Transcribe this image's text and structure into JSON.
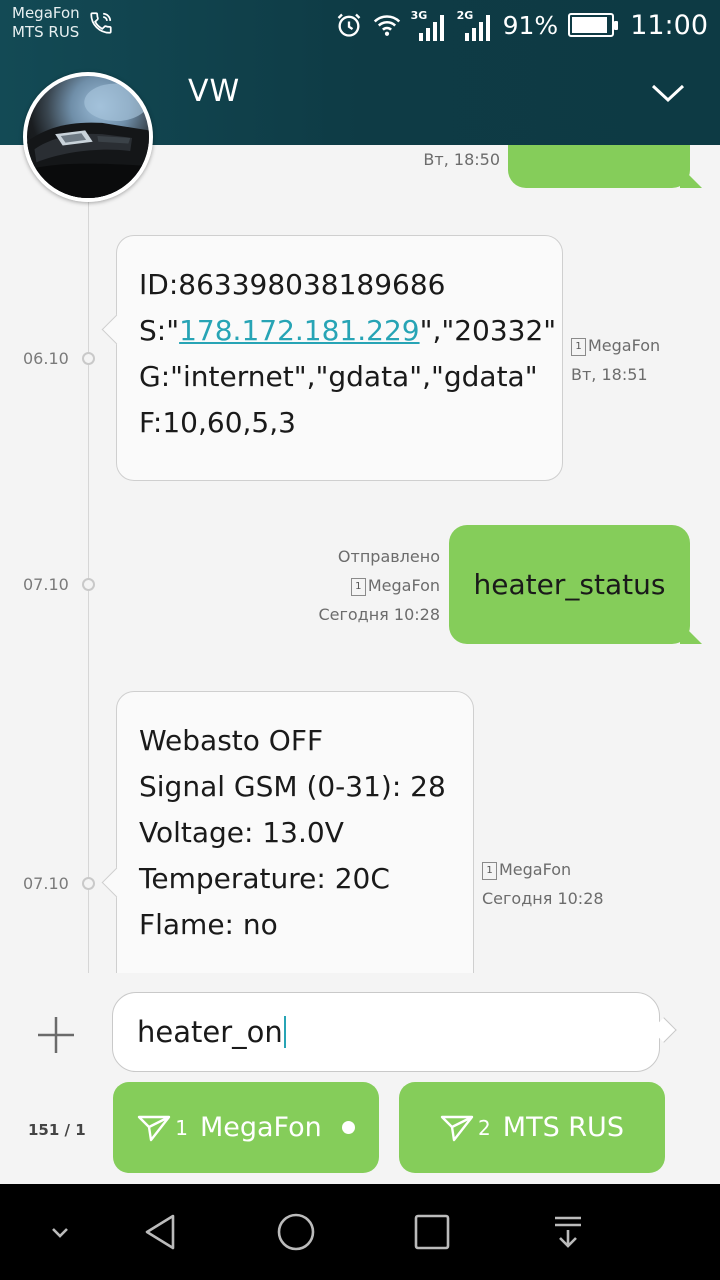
{
  "status_bar": {
    "carrier_1": "MegaFon",
    "carrier_2": "MTS RUS",
    "net_1": "3G",
    "net_2": "2G",
    "battery_pct": "91%",
    "battery_level": 0.91,
    "time": "11:00"
  },
  "header": {
    "contact_name": "VW"
  },
  "messages": {
    "prev_out": {
      "time": "Вт, 18:50"
    },
    "in_1": {
      "date": "06.10",
      "line1": "ID:863398038189686",
      "line2_prefix": "S:\"",
      "line2_link": "178.172.181.229",
      "line2_suffix": "\",\"20332\"",
      "line3": "G:\"internet\",\"gdata\",\"gdata\"",
      "line4": "F:10,60,5,3",
      "sim": "1",
      "carrier": "MegaFon",
      "time": "Вт, 18:51"
    },
    "out_1": {
      "date": "07.10",
      "text": "heater_status",
      "status": "Отправлено",
      "sim": "1",
      "carrier": "MegaFon",
      "time": "Сегодня 10:28"
    },
    "in_2": {
      "date": "07.10",
      "line1": "Webasto OFF",
      "line2": "Signal GSM (0-31): 28",
      "line3": "Voltage: 13.0V",
      "line4": "Temperature: 20C",
      "line5": "Flame: no",
      "sim": "1",
      "carrier": "MegaFon",
      "time": "Сегодня 10:28"
    }
  },
  "compose": {
    "input_value": "heater_on",
    "counter": "151 / 1",
    "send_1": {
      "sim": "1",
      "label": "MegaFon"
    },
    "send_2": {
      "sim": "2",
      "label": "MTS RUS"
    }
  },
  "colors": {
    "header": "#0e3b45",
    "bubble_out": "#85cd5a",
    "link": "#27a4b5",
    "background": "#f4f4f4"
  },
  "icons": [
    "phone-call-icon",
    "alarm-icon",
    "wifi-icon",
    "signal-icon",
    "battery-icon",
    "chevron-down-icon",
    "plus-icon",
    "send-icon",
    "back-icon",
    "home-icon",
    "recents-icon",
    "notifications-icon",
    "collapse-icon"
  ]
}
